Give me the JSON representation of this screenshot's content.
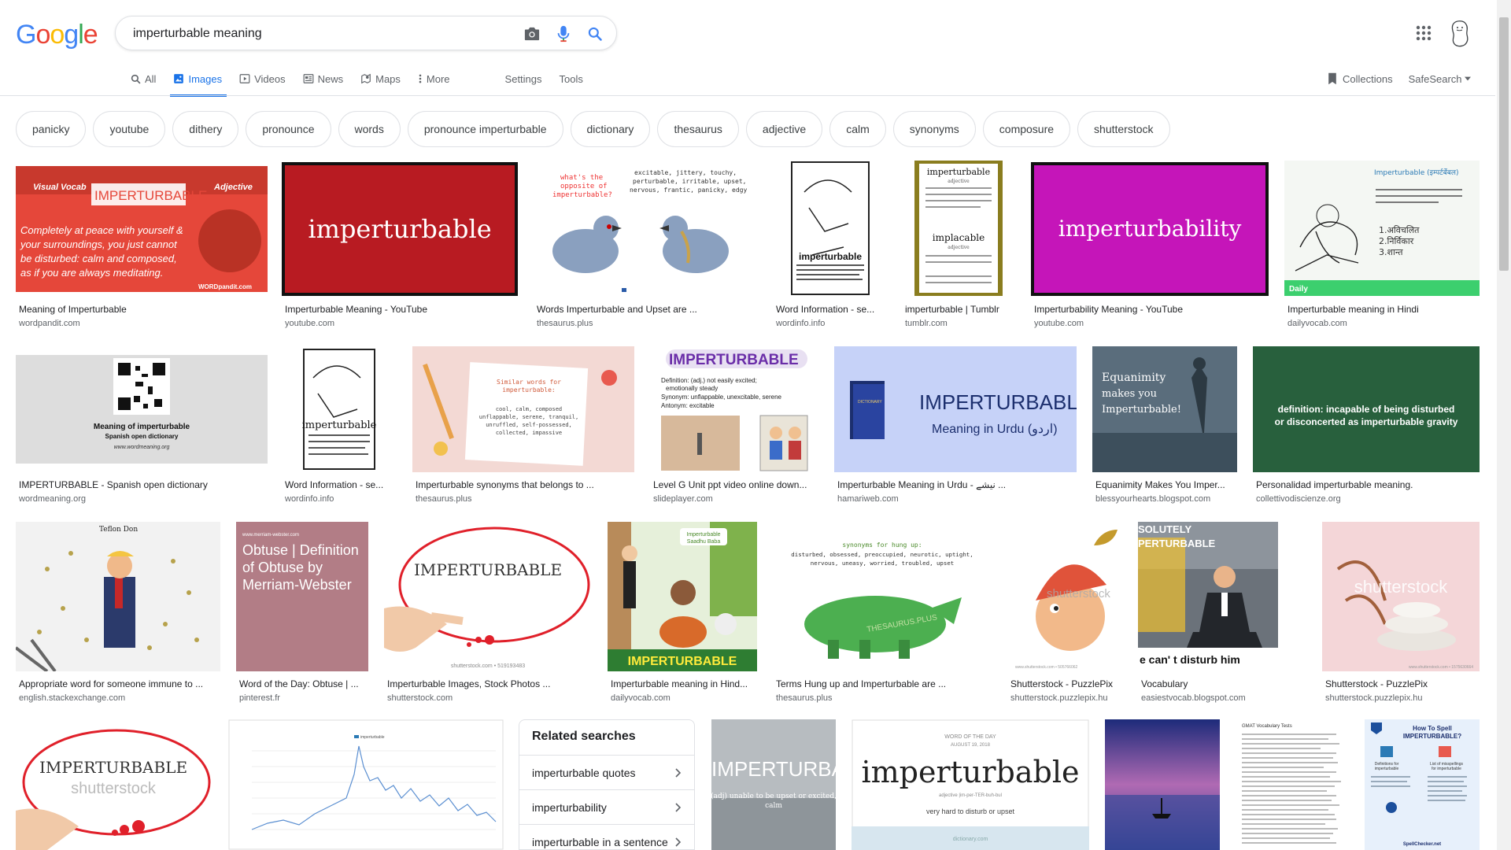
{
  "logo": {
    "letters": [
      "G",
      "o",
      "o",
      "g",
      "l",
      "e"
    ],
    "colors": [
      "#4285f4",
      "#ea4335",
      "#fbbc05",
      "#4285f4",
      "#34a853",
      "#ea4335"
    ]
  },
  "search": {
    "query": "imperturbable meaning"
  },
  "icons": {
    "camera": "camera-icon",
    "mic": "mic-icon",
    "search": "search-icon",
    "apps": "apps-grid-icon"
  },
  "tabs": [
    {
      "label": "All",
      "icon": "search-icon"
    },
    {
      "label": "Images",
      "icon": "image-icon",
      "active": true
    },
    {
      "label": "Videos",
      "icon": "video-icon"
    },
    {
      "label": "News",
      "icon": "news-icon"
    },
    {
      "label": "Maps",
      "icon": "map-icon"
    },
    {
      "label": "More",
      "icon": "more-icon"
    }
  ],
  "settings_label": "Settings",
  "tools_label": "Tools",
  "collections_label": "Collections",
  "safesearch_label": "SafeSearch",
  "accent": "#1a73e8",
  "chips": [
    "panicky",
    "youtube",
    "dithery",
    "pronounce",
    "words",
    "pronounce imperturbable",
    "dictionary",
    "thesaurus",
    "adjective",
    "calm",
    "synonyms",
    "composure",
    "shutterstock"
  ],
  "results": {
    "row1": [
      {
        "caption": "Meaning of Imperturbable",
        "source": "wordpandit.com",
        "img_text": [
          "Visual Vocab",
          "IMPERTURBABLE",
          "Adjective",
          "Completely at peace with yourself &",
          "your surroundings, you just cannot",
          "be disturbed: calm and composed,",
          "as if you are always meditating.",
          "WORDpandit.com"
        ]
      },
      {
        "caption": "Imperturbable Meaning - YouTube",
        "source": "youtube.com",
        "img_text": [
          "imperturbable"
        ]
      },
      {
        "caption": "Words Imperturbable and Upset are ...",
        "source": "thesaurus.plus",
        "img_text": [
          "what's the",
          "opposite of",
          "imperturbable?",
          "excitable, jittery, touchy,",
          "perturbable, irritable, upset,",
          "nervous, frantic, panicky, edgy"
        ]
      },
      {
        "caption": "Word Information - se...",
        "source": "wordinfo.info",
        "img_text": [
          "imperturbable"
        ]
      },
      {
        "caption": "imperturbable | Tumblr",
        "source": "tumblr.com",
        "img_text": [
          "imperturbable",
          "adjective",
          "implacable",
          "adjective"
        ]
      },
      {
        "caption": "Imperturbability Meaning - YouTube",
        "source": "youtube.com",
        "img_text": [
          "imperturbability"
        ]
      },
      {
        "caption": "Imperturbable meaning in Hindi",
        "source": "dailyvocab.com",
        "img_text": [
          "Imperturbable (इम्पर्टर्बेबल)",
          "1.अविचलित",
          "2.निर्विकार",
          "3.शान्त",
          "Daily"
        ]
      }
    ],
    "row2": [
      {
        "caption": "IMPERTURBABLE - Spanish open dictionary",
        "source": "wordmeaning.org",
        "img_text": [
          "Meaning of imperturbable",
          "Spanish open dictionary",
          "www.wordmeaning.org"
        ]
      },
      {
        "caption": "Word Information - se...",
        "source": "wordinfo.info",
        "img_text": [
          "imperturbable"
        ]
      },
      {
        "caption": "Imperturbable synonyms that belongs to ...",
        "source": "thesaurus.plus",
        "img_text": [
          "Similar words for",
          "imperturbable:",
          "cool, calm, composed",
          "unflappable, serene, tranquil,",
          "unruffled, self-possessed,",
          "collected, impassive"
        ]
      },
      {
        "caption": "Level G Unit ppt video online down...",
        "source": "slideplayer.com",
        "img_text": [
          "IMPERTURBABLE",
          "Definition: (adj.) not easily excited;",
          "emotionally steady",
          "Synonym: unflappable, unexcitable, serene",
          "Antonym: excitable"
        ]
      },
      {
        "caption": "Imperturbable Meaning in Urdu - نیشے ...",
        "source": "hamariweb.com",
        "img_text": [
          "IMPERTURBABLE",
          "Meaning in Urdu (اردو)",
          "DICTIONARY"
        ]
      },
      {
        "caption": "Equanimity Makes You Imper...",
        "source": "blessyourhearts.blogspot.com",
        "img_text": [
          "Equanimity",
          "makes you",
          "Imperturbable!"
        ]
      },
      {
        "caption": "Personalidad imperturbable meaning.",
        "source": "collettivodiscienze.org",
        "img_text": [
          "definition: incapable of being disturbed",
          "or disconcerted as imperturbable gravity"
        ]
      }
    ],
    "row3": [
      {
        "caption": "Appropriate word for someone immune to ...",
        "source": "english.stackexchange.com",
        "img_text": [
          "Teflon Don"
        ]
      },
      {
        "caption": "Word of the Day: Obtuse | ...",
        "source": "pinterest.fr",
        "img_text": [
          "www.merriam-webster.com",
          "Obtuse | Definition",
          "of Obtuse by",
          "Merriam-Webster"
        ]
      },
      {
        "caption": "Imperturbable Images, Stock Photos ...",
        "source": "shutterstock.com",
        "img_text": [
          "IMPERTURBABLE",
          "shutterstock.com • 519193483"
        ]
      },
      {
        "caption": "Imperturbable meaning in Hind...",
        "source": "dailyvocab.com",
        "img_text": [
          "Imperturbable",
          "Saadhu Baba",
          "IMPERTURBABLE"
        ]
      },
      {
        "caption": "Terms Hung up and Imperturbable are ...",
        "source": "thesaurus.plus",
        "img_text": [
          "synonyms for hung up:",
          "disturbed, obsessed, preoccupied, neurotic, uptight,",
          "nervous, uneasy, worried, troubled, upset",
          "THESAURUS.PLUS"
        ]
      },
      {
        "caption": "Shutterstock - PuzzlePix",
        "source": "shutterstock.puzzlepix.hu",
        "img_text": [
          "shutterstock",
          "www.shutterstock.com • 505766062"
        ]
      },
      {
        "caption": "Vocabulary",
        "source": "easiestvocab.blogspot.com",
        "img_text": [
          "SOLUTELY",
          "PERTURBABLE",
          "e can' t disturb him"
        ]
      },
      {
        "caption": "Shutterstock - PuzzlePix",
        "source": "shutterstock.puzzlepix.hu",
        "img_text": [
          "shutterstock",
          "www.shutterstock.com • 1575630664"
        ]
      }
    ],
    "row4": [
      {
        "img_text": [
          "IMPERTURBABLE",
          "shutterstock"
        ]
      },
      {
        "img_text": [
          "imperturbable"
        ]
      },
      {
        "img_text": [
          "IMPERTURBABLE",
          "(adj) unable to be upset or excited,",
          "calm"
        ]
      },
      {
        "img_text": [
          "WORD OF THE DAY",
          "AUGUST 19, 2018",
          "imperturbable",
          "adjective |im-per-TER-buh-bul",
          "very hard to disturb or upset",
          "dictionary.com"
        ]
      },
      {
        "img_text": []
      },
      {
        "img_text": [
          "GMAT Vocabulary Tests"
        ]
      },
      {
        "img_text": [
          "How To Spell",
          "IMPERTURBABLE?",
          "Definitions for",
          "imperturbable",
          "List of misspellings",
          "for imperturbable",
          "SpellChecker.net"
        ]
      }
    ]
  },
  "related": {
    "title": "Related searches",
    "items": [
      "imperturbable quotes",
      "imperturbability",
      "imperturbable in a sentence"
    ]
  }
}
